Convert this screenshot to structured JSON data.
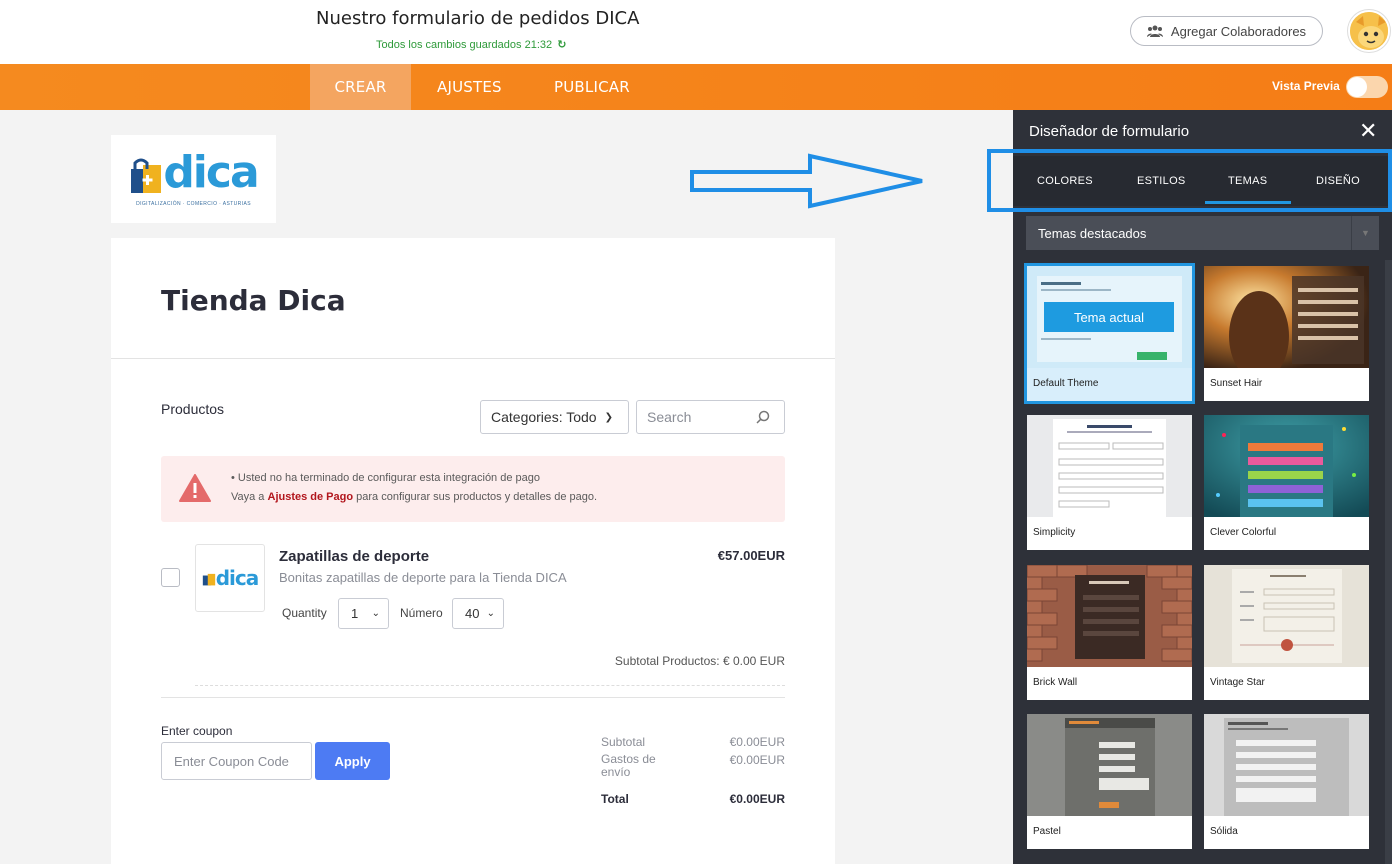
{
  "header": {
    "form_title": "Nuestro formulario de pedidos DICA",
    "save_status": "Todos los cambios guardados 21:32",
    "collab_button": "Agregar Colaboradores"
  },
  "nav": {
    "tabs": [
      {
        "label": "CREAR",
        "active": true
      },
      {
        "label": "AJUSTES",
        "active": false
      },
      {
        "label": "PUBLICAR",
        "active": false
      }
    ],
    "preview_label": "Vista Previa"
  },
  "logo": {
    "text": "dica",
    "tagline": "DIGITALIZACIÓN · COMERCIO · ASTURIAS"
  },
  "form": {
    "heading": "Tienda Dica",
    "products_label": "Productos",
    "categories_value": "Categories: Todo",
    "search_placeholder": "Search",
    "alert": {
      "line1": "• Usted no ha terminado de configurar esta integración de pago",
      "line2_pre": "Vaya a ",
      "line2_link": "Ajustes de Pago",
      "line2_post": " para configurar sus productos y detalles de pago."
    },
    "product": {
      "name": "Zapatillas de deporte",
      "description": "Bonitas zapatillas de deporte para la Tienda DICA",
      "price": "€57.00EUR",
      "quantity_label": "Quantity",
      "quantity_value": "1",
      "number_label": "Número",
      "number_value": "40",
      "thumb_text": "dica"
    },
    "subtotal_products": "Subtotal Productos:  € 0.00 EUR",
    "coupon": {
      "label": "Enter coupon",
      "placeholder": "Enter Coupon Code",
      "apply": "Apply"
    },
    "totals": [
      {
        "label": "Subtotal",
        "value": "€0.00EUR"
      },
      {
        "label": "Gastos de envío",
        "value": "€0.00EUR"
      },
      {
        "label": "Total",
        "value": "€0.00EUR"
      }
    ]
  },
  "designer": {
    "title": "Diseñador de formulario",
    "tabs": [
      {
        "label": "COLORES",
        "active": false
      },
      {
        "label": "ESTILOS",
        "active": false
      },
      {
        "label": "TEMAS",
        "active": true
      },
      {
        "label": "DISEÑO",
        "active": false
      }
    ],
    "theme_filter": "Temas destacados",
    "current_badge": "Tema actual",
    "themes": [
      {
        "name": "Default Theme",
        "current": true
      },
      {
        "name": "Sunset Hair",
        "current": false
      },
      {
        "name": "Simplicity",
        "current": false
      },
      {
        "name": "Clever Colorful",
        "current": false
      },
      {
        "name": "Brick Wall",
        "current": false
      },
      {
        "name": "Vintage Star",
        "current": false
      },
      {
        "name": "Pastel",
        "current": false
      },
      {
        "name": "Sólida",
        "current": false
      }
    ]
  },
  "colors": {
    "brand_orange": "#f58a1f",
    "accent_blue": "#2196e0",
    "apply_blue": "#4d7bf3",
    "panel_dark": "#2e3139",
    "save_green": "#2e9a3a"
  }
}
